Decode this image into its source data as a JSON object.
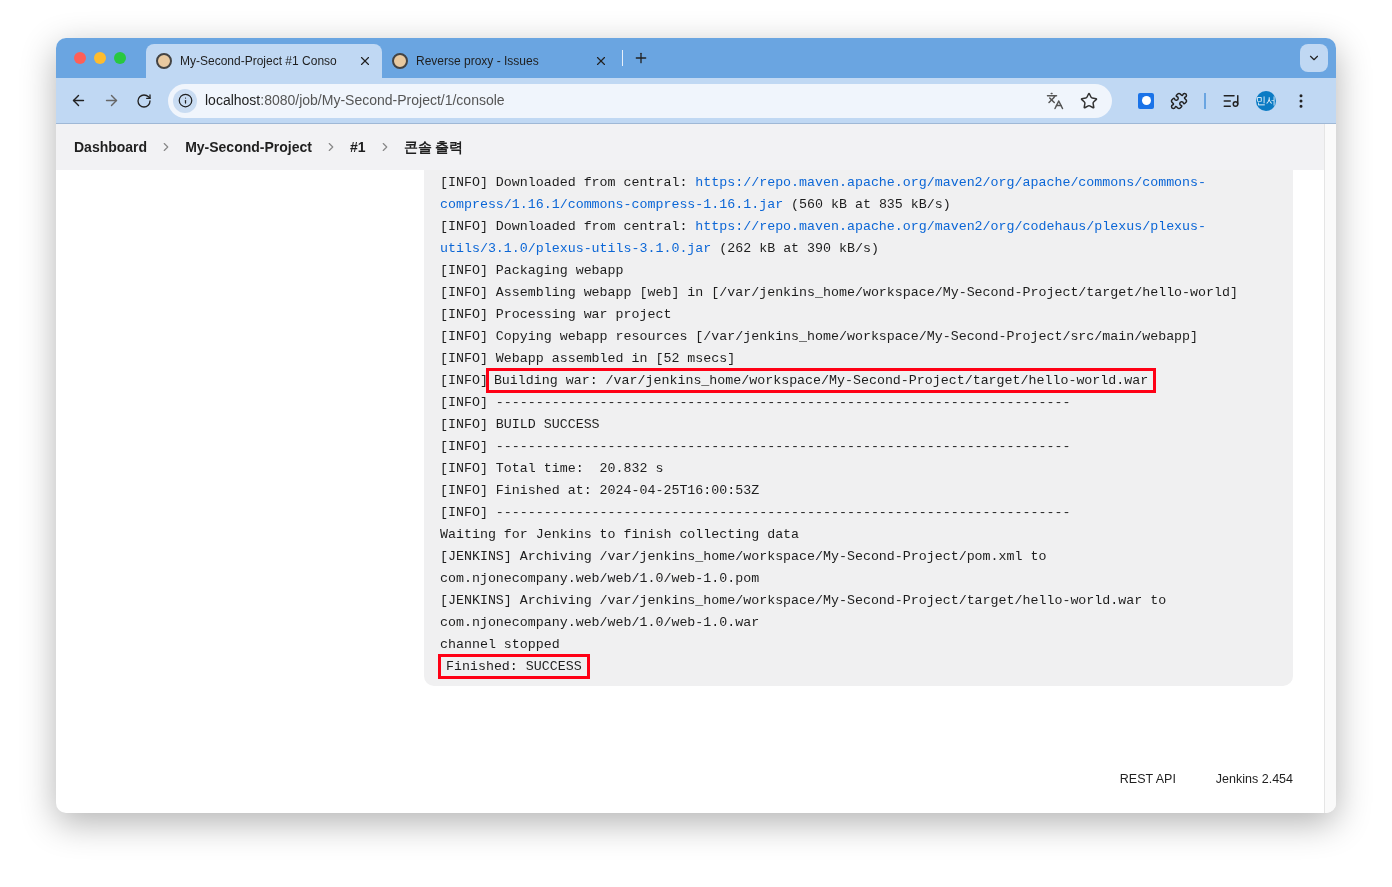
{
  "browser": {
    "tabs": [
      {
        "title": "My-Second-Project #1 Conso",
        "selected": true
      },
      {
        "title": "Reverse proxy - Issues",
        "selected": false
      }
    ],
    "url": {
      "host": "localhost",
      "path": ":8080/job/My-Second-Project/1/console"
    },
    "profile": "민서"
  },
  "breadcrumb": [
    "Dashboard",
    "My-Second-Project",
    "#1",
    "콘솔 출력"
  ],
  "console": [
    {
      "segments": [
        {
          "kind": "text",
          "text": "[INFO] Downloaded from central: "
        },
        {
          "kind": "link",
          "text": "https://repo.maven.apache.org/maven2/org/apache/commons/commons-"
        }
      ]
    },
    {
      "segments": [
        {
          "kind": "link",
          "text": "compress/1.16.1/commons-compress-1.16.1.jar"
        },
        {
          "kind": "text",
          "text": " (560 kB at 835 kB/s)"
        }
      ]
    },
    {
      "segments": [
        {
          "kind": "text",
          "text": "[INFO] Downloaded from central: "
        },
        {
          "kind": "link",
          "text": "https://repo.maven.apache.org/maven2/org/codehaus/plexus/plexus-"
        }
      ]
    },
    {
      "segments": [
        {
          "kind": "link",
          "text": "utils/3.1.0/plexus-utils-3.1.0.jar"
        },
        {
          "kind": "text",
          "text": " (262 kB at 390 kB/s)"
        }
      ]
    },
    {
      "segments": [
        {
          "kind": "text",
          "text": "[INFO] Packaging webapp"
        }
      ]
    },
    {
      "segments": [
        {
          "kind": "text",
          "text": "[INFO] Assembling webapp [web] in [/var/jenkins_home/workspace/My-Second-Project/target/hello-world]"
        }
      ]
    },
    {
      "segments": [
        {
          "kind": "text",
          "text": "[INFO] Processing war project"
        }
      ]
    },
    {
      "segments": [
        {
          "kind": "text",
          "text": "[INFO] Copying webapp resources [/var/jenkins_home/workspace/My-Second-Project/src/main/webapp]"
        }
      ]
    },
    {
      "segments": [
        {
          "kind": "text",
          "text": "[INFO] Webapp assembled in [52 msecs]"
        }
      ]
    },
    {
      "segments": [
        {
          "kind": "text",
          "text": "[INFO]"
        },
        {
          "kind": "highlight",
          "text": "Building war: /var/jenkins_home/workspace/My-Second-Project/target/hello-world.war"
        }
      ]
    },
    {
      "segments": [
        {
          "kind": "text",
          "text": "[INFO] ------------------------------------------------------------------------"
        }
      ]
    },
    {
      "segments": [
        {
          "kind": "text",
          "text": "[INFO] BUILD SUCCESS"
        }
      ]
    },
    {
      "segments": [
        {
          "kind": "text",
          "text": "[INFO] ------------------------------------------------------------------------"
        }
      ]
    },
    {
      "segments": [
        {
          "kind": "text",
          "text": "[INFO] Total time:  20.832 s"
        }
      ]
    },
    {
      "segments": [
        {
          "kind": "text",
          "text": "[INFO] Finished at: 2024-04-25T16:00:53Z"
        }
      ]
    },
    {
      "segments": [
        {
          "kind": "text",
          "text": "[INFO] ------------------------------------------------------------------------"
        }
      ]
    },
    {
      "segments": [
        {
          "kind": "text",
          "text": "Waiting for Jenkins to finish collecting data"
        }
      ]
    },
    {
      "segments": [
        {
          "kind": "text",
          "text": "[JENKINS] Archiving /var/jenkins_home/workspace/My-Second-Project/pom.xml to"
        }
      ]
    },
    {
      "segments": [
        {
          "kind": "text",
          "text": "com.njonecompany.web/web/1.0/web-1.0.pom"
        }
      ]
    },
    {
      "segments": [
        {
          "kind": "text",
          "text": "[JENKINS] Archiving /var/jenkins_home/workspace/My-Second-Project/target/hello-world.war to"
        }
      ]
    },
    {
      "segments": [
        {
          "kind": "text",
          "text": "com.njonecompany.web/web/1.0/web-1.0.war"
        }
      ]
    },
    {
      "segments": [
        {
          "kind": "text",
          "text": "channel stopped"
        }
      ]
    },
    {
      "segments": [
        {
          "kind": "highlight",
          "text": "Finished: SUCCESS"
        }
      ]
    }
  ],
  "footer": [
    "REST API",
    "Jenkins 2.454"
  ]
}
